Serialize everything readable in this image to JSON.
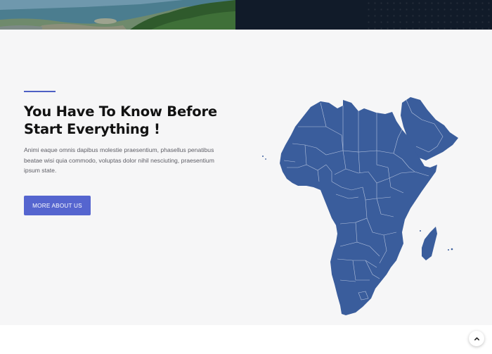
{
  "hero": {
    "heading_line1": "You Have To Know Before",
    "heading_line2": "Start Everything !",
    "description": "Animi eaque omnis dapibus molestie praesentium, phasellus penatibus beatae wisi quia commodo, voluptas dolor nihil nesciuting, praesentium ipsum state.",
    "button_label": "MORE ABOUT US"
  },
  "colors": {
    "accent": "#5565cf",
    "map_fill": "#3a5d9c",
    "background": "#f6f6f7",
    "dark_banner": "#111b29"
  },
  "icons": {
    "scroll_top": "chevron-up-icon"
  }
}
